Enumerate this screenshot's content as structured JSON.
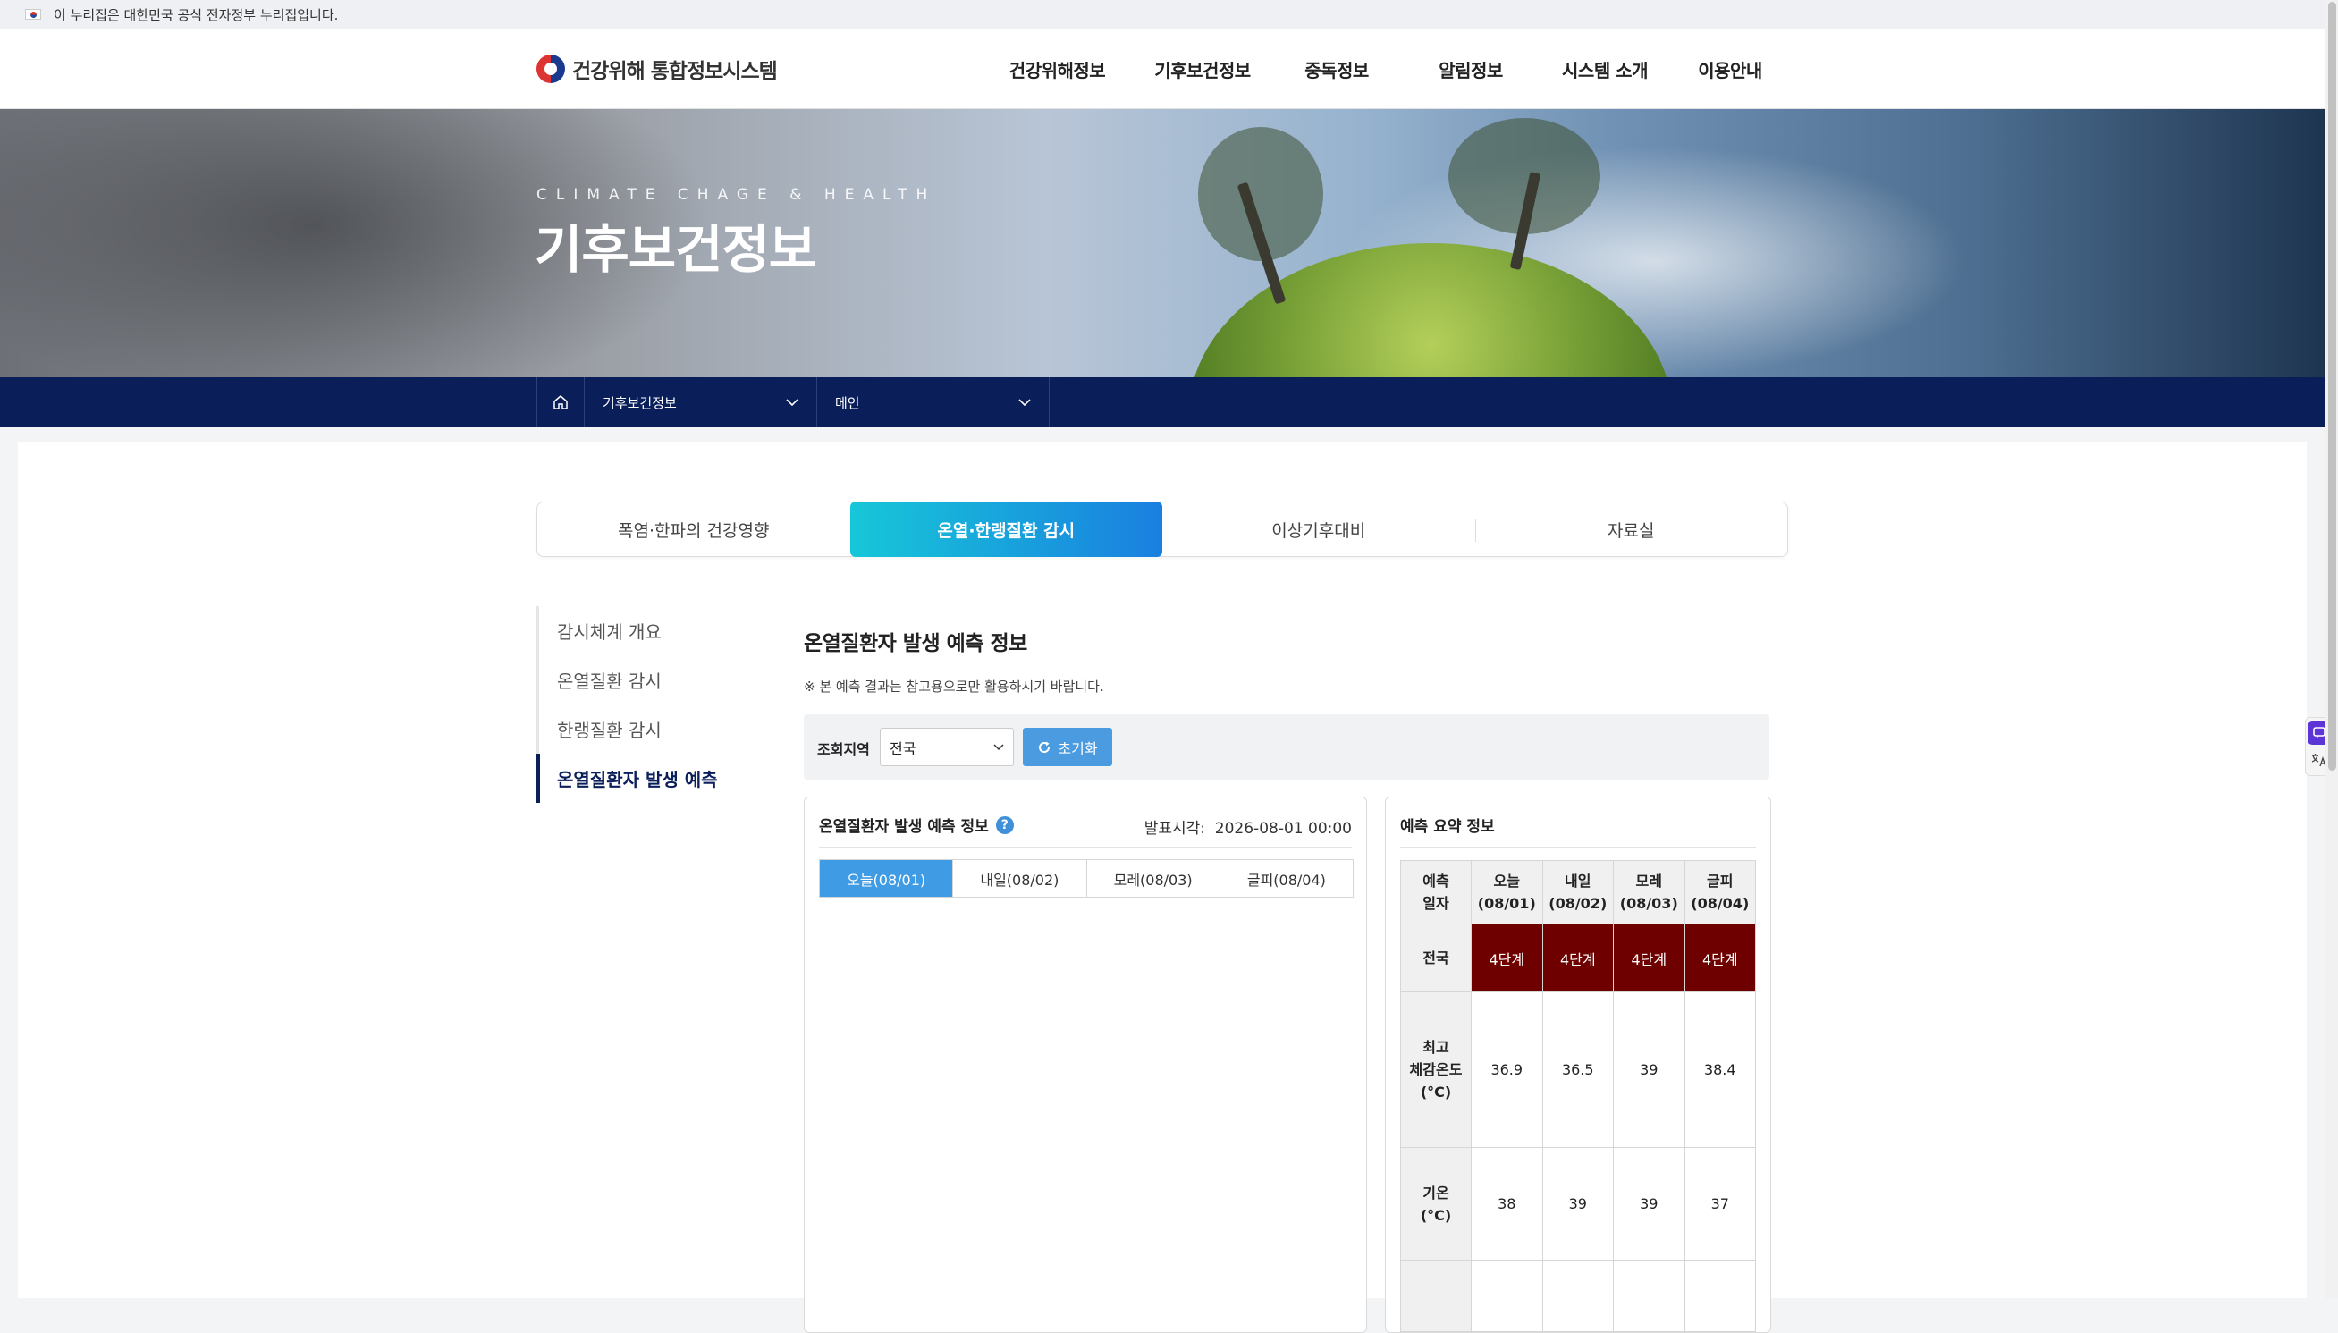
{
  "gov_banner": {
    "text": "이 누리집은 대한민국 공식 전자정부 누리집입니다."
  },
  "header": {
    "logo_text": "건강위해 통합정보시스템",
    "nav": [
      "건강위해정보",
      "기후보건정보",
      "중독정보",
      "알림정보",
      "시스템 소개",
      "이용안내"
    ]
  },
  "hero": {
    "eyebrow": "CLIMATE CHAGE & HEALTH",
    "title": "기후보건정보"
  },
  "breadcrumb": {
    "level1": "기후보건정보",
    "level2": "메인"
  },
  "tabs": [
    "폭염·한파의 건강영향",
    "온열·한랭질환 감시",
    "이상기후대비",
    "자료실"
  ],
  "active_tab": 1,
  "side_menu": [
    "감시체계 개요",
    "온열질환 감시",
    "한랭질환 감시",
    "온열질환자 발생 예측"
  ],
  "main": {
    "title": "온열질환자 발생 예측 정보",
    "notice": "※ 본 예측 결과는 참고용으로만 활용하시기 바랍니다.",
    "filter": {
      "label": "조회지역",
      "region": "전국",
      "reset_label": "초기화"
    }
  },
  "forecast_panel": {
    "title": "온열질환자 발생 예측 정보",
    "issue_label": "발표시각:",
    "issue_time": "2026-08-01 00:00",
    "day_tabs": [
      "오늘(08/01)",
      "내일(08/02)",
      "모레(08/03)",
      "글피(08/04)"
    ]
  },
  "summary_panel": {
    "title": "예측 요약 정보",
    "header": [
      "예측\n일자",
      "오늘\n(08/01)",
      "내일\n(08/02)",
      "모레\n(08/03)",
      "글피\n(08/04)"
    ],
    "rows": [
      {
        "label": "전국",
        "values": [
          "4단계",
          "4단계",
          "4단계",
          "4단계"
        ]
      },
      {
        "label": "최고\n체감온도\n(°C)",
        "values": [
          "36.9",
          "36.5",
          "39",
          "38.4"
        ]
      },
      {
        "label": "기온\n(°C)",
        "values": [
          "38",
          "39",
          "39",
          "37"
        ]
      },
      {
        "label": "",
        "values": [
          "",
          "",
          "",
          ""
        ]
      }
    ]
  },
  "colors": {
    "navy": "#0a1e5a",
    "level4": "#6e0000",
    "accent_blue": "#3f9be3"
  },
  "float_widget": [
    "chat-icon",
    "translate-icon"
  ]
}
